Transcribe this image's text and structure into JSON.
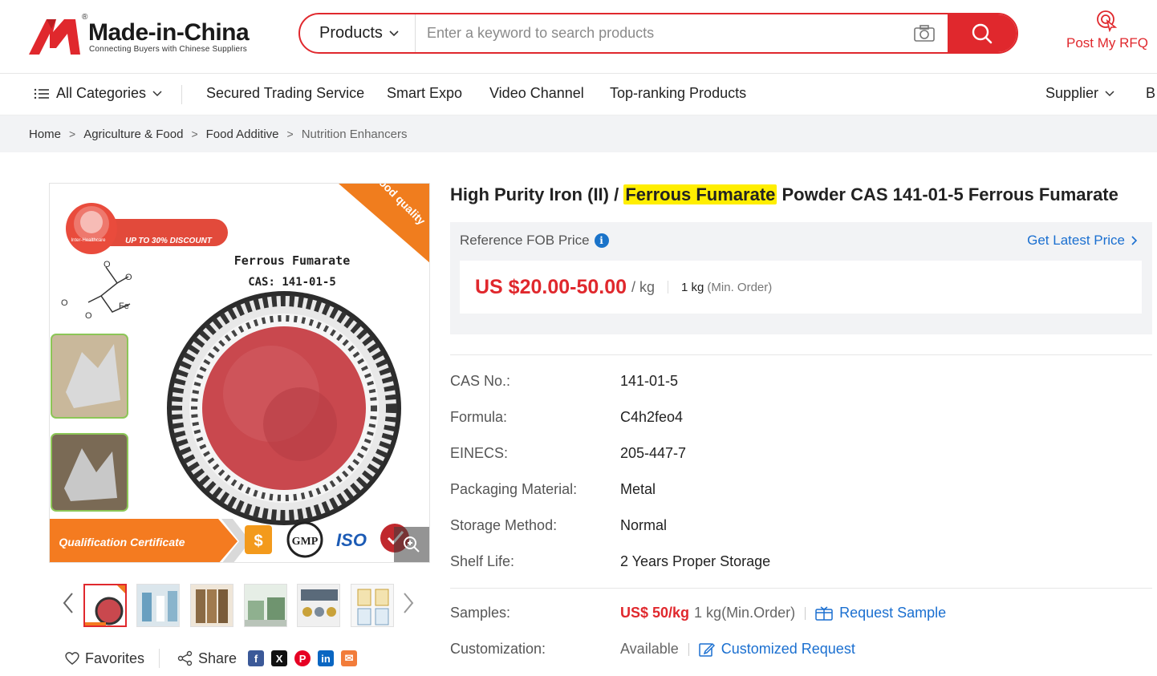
{
  "header": {
    "logo_name": "Made-in-China",
    "logo_reg": "®",
    "logo_tagline": "Connecting Buyers with Chinese Suppliers",
    "search_category": "Products",
    "search_placeholder": "Enter a keyword to search products",
    "rfq_label": "Post My RFQ",
    "accent_color": "#e0282d"
  },
  "nav": {
    "all_categories": "All Categories",
    "items": [
      "Secured Trading Service",
      "Smart Expo",
      "Video Channel",
      "Top-ranking Products"
    ],
    "supplier": "Supplier",
    "cut_item": "B"
  },
  "breadcrumb": [
    "Home",
    "Agriculture & Food",
    "Food Additive",
    "Nutrition Enhancers"
  ],
  "gallery": {
    "banner_text": "UP TO 30% DISCOUNT",
    "badge_brand": "Inter-Healthcare",
    "corner_ribbon": "Good quality",
    "product_name": "Ferrous Fumarate",
    "cas_line": "CAS:  141-01-5",
    "molecule_fe": "Fe",
    "molecule_o": "O",
    "cert_banner": "Qualification Certificate",
    "cert_dollar": "$",
    "cert_gmp": "GMP",
    "cert_iso": "ISO",
    "active_thumb": 1
  },
  "actions": {
    "favorites": "Favorites",
    "share": "Share",
    "social_f": "f",
    "social_x": "X",
    "social_p": "P",
    "social_in": "in",
    "social_mail": "✉"
  },
  "product": {
    "title_before": "High Purity Iron (II) / ",
    "title_highlight": "Ferrous Fumarate",
    "title_after": " Powder CAS 141-01-5 Ferrous Fumarate",
    "ref_price_label": "Reference FOB Price",
    "info_glyph": "i",
    "get_latest": "Get Latest Price",
    "price": "US $20.00-50.00",
    "price_unit": "/ kg",
    "moq": "1 kg",
    "moq_note": "(Min. Order)"
  },
  "specs": [
    {
      "label": "CAS No.:",
      "value": "141-01-5"
    },
    {
      "label": "Formula:",
      "value": "C4h2feo4"
    },
    {
      "label": "EINECS:",
      "value": "205-447-7"
    },
    {
      "label": "Packaging Material:",
      "value": "Metal"
    },
    {
      "label": "Storage Method:",
      "value": "Normal"
    },
    {
      "label": "Shelf Life:",
      "value": "2 Years Proper Storage"
    }
  ],
  "samples": {
    "label": "Samples:",
    "price": "US$ 50/kg",
    "moq": "1 kg(Min.Order)",
    "link": "Request Sample"
  },
  "customization": {
    "label": "Customization:",
    "value": "Available",
    "link": "Customized Request"
  }
}
